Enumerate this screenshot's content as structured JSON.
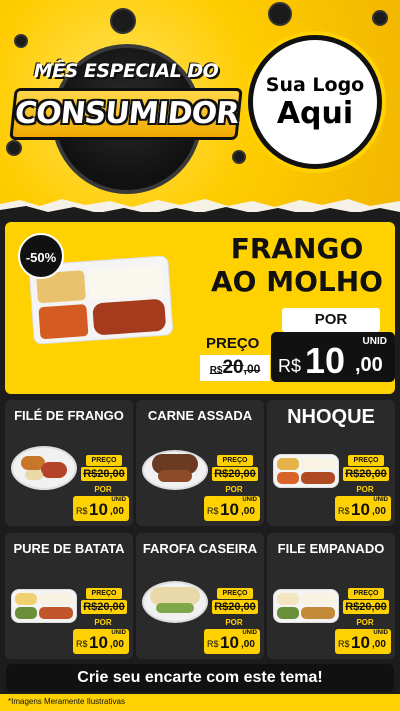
{
  "header": {
    "badge_line1": "MÊS ESPECIAL DO",
    "badge_line2": "CONSUMIDOR",
    "logo_line1": "Sua Logo",
    "logo_line2": "Aqui"
  },
  "featured": {
    "discount": "-50%",
    "title_line1": "FRANGO",
    "title_line2": "AO MOLHO",
    "por_label": "POR",
    "preco_label": "PREÇO",
    "old_price": {
      "currency": "R$",
      "int": "20",
      "cents": ",00"
    },
    "new_price": {
      "unit": "UNID",
      "currency": "R$",
      "int": "10",
      "cents": ",00"
    }
  },
  "cards": [
    {
      "title": "FILÉ DE FRANGO",
      "preco_label": "PREÇO",
      "old_price": "R$20,00",
      "por_label": "POR",
      "unit": "UNID",
      "currency": "R$",
      "int": "10",
      "cents": ",00"
    },
    {
      "title": "CARNE ASSADA",
      "preco_label": "PREÇO",
      "old_price": "R$20,00",
      "por_label": "POR",
      "unit": "UNID",
      "currency": "R$",
      "int": "10",
      "cents": ",00"
    },
    {
      "title": "NHOQUE",
      "preco_label": "PREÇO",
      "old_price": "R$20,00",
      "por_label": "POR",
      "unit": "UNID",
      "currency": "R$",
      "int": "10",
      "cents": ",00"
    },
    {
      "title": "PURE DE BATATA",
      "preco_label": "PREÇO",
      "old_price": "R$20,00",
      "por_label": "POR",
      "unit": "UNID",
      "currency": "R$",
      "int": "10",
      "cents": ",00"
    },
    {
      "title": "FAROFA CASEIRA",
      "preco_label": "PREÇO",
      "old_price": "R$20,00",
      "por_label": "POR",
      "unit": "UNID",
      "currency": "R$",
      "int": "10",
      "cents": ",00"
    },
    {
      "title": "FILE EMPANADO",
      "preco_label": "PREÇO",
      "old_price": "R$20,00",
      "por_label": "POR",
      "unit": "UNID",
      "currency": "R$",
      "int": "10",
      "cents": ",00"
    }
  ],
  "footer": {
    "cta": "Crie seu encarte com este tema!",
    "disclaimer": "*Imagens Meramente Ilustrativas"
  },
  "colors": {
    "brand_yellow": "#ffd100",
    "dark": "#1c1c1c",
    "card": "#2a2a2a"
  }
}
